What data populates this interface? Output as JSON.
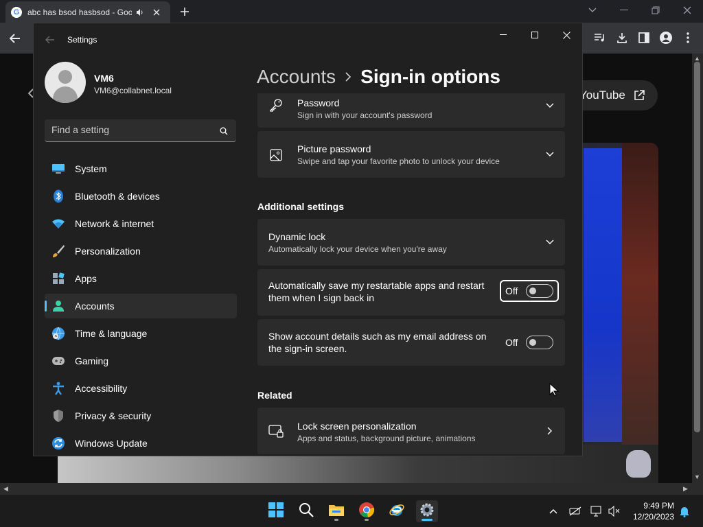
{
  "browser": {
    "tab_title": "abc has bsod hasbsod - Goo",
    "favicon_letter": "G",
    "new_tab": "+",
    "youtube_chip_label": "YouTube"
  },
  "settings": {
    "window_title": "Settings",
    "profile": {
      "name": "VM6",
      "email": "VM6@collabnet.local"
    },
    "search": {
      "placeholder": "Find a setting"
    },
    "nav": [
      {
        "label": "System",
        "icon": "monitor-icon",
        "selected": false
      },
      {
        "label": "Bluetooth & devices",
        "icon": "bluetooth-icon",
        "selected": false
      },
      {
        "label": "Network & internet",
        "icon": "wifi-icon",
        "selected": false
      },
      {
        "label": "Personalization",
        "icon": "brush-icon",
        "selected": false
      },
      {
        "label": "Apps",
        "icon": "apps-icon",
        "selected": false
      },
      {
        "label": "Accounts",
        "icon": "person-icon",
        "selected": true
      },
      {
        "label": "Time & language",
        "icon": "globe-clock-icon",
        "selected": false
      },
      {
        "label": "Gaming",
        "icon": "gamepad-icon",
        "selected": false
      },
      {
        "label": "Accessibility",
        "icon": "accessibility-icon",
        "selected": false
      },
      {
        "label": "Privacy & security",
        "icon": "shield-icon",
        "selected": false
      },
      {
        "label": "Windows Update",
        "icon": "update-icon",
        "selected": false
      }
    ],
    "breadcrumb": {
      "parent": "Accounts",
      "current": "Sign-in options"
    },
    "cards": {
      "password": {
        "title": "Password",
        "desc": "Sign in with your account's password"
      },
      "picture_password": {
        "title": "Picture password",
        "desc": "Swipe and tap your favorite photo to unlock your device"
      },
      "additional_header": "Additional settings",
      "dynamic_lock": {
        "title": "Dynamic lock",
        "desc": "Automatically lock your device when you're away"
      },
      "restart_apps": {
        "line1": "Automatically save my restartable apps and restart",
        "line2": "them when I sign back in",
        "state": "Off"
      },
      "account_details": {
        "line1": "Show account details such as my email address on",
        "line2": "the sign-in screen.",
        "state": "Off"
      },
      "related_header": "Related",
      "lock_screen": {
        "title": "Lock screen personalization",
        "desc": "Apps and status, background picture, animations"
      }
    }
  },
  "taskbar": {
    "time": "9:49 PM",
    "date": "12/20/2023",
    "accent": "#4cc2ff"
  }
}
